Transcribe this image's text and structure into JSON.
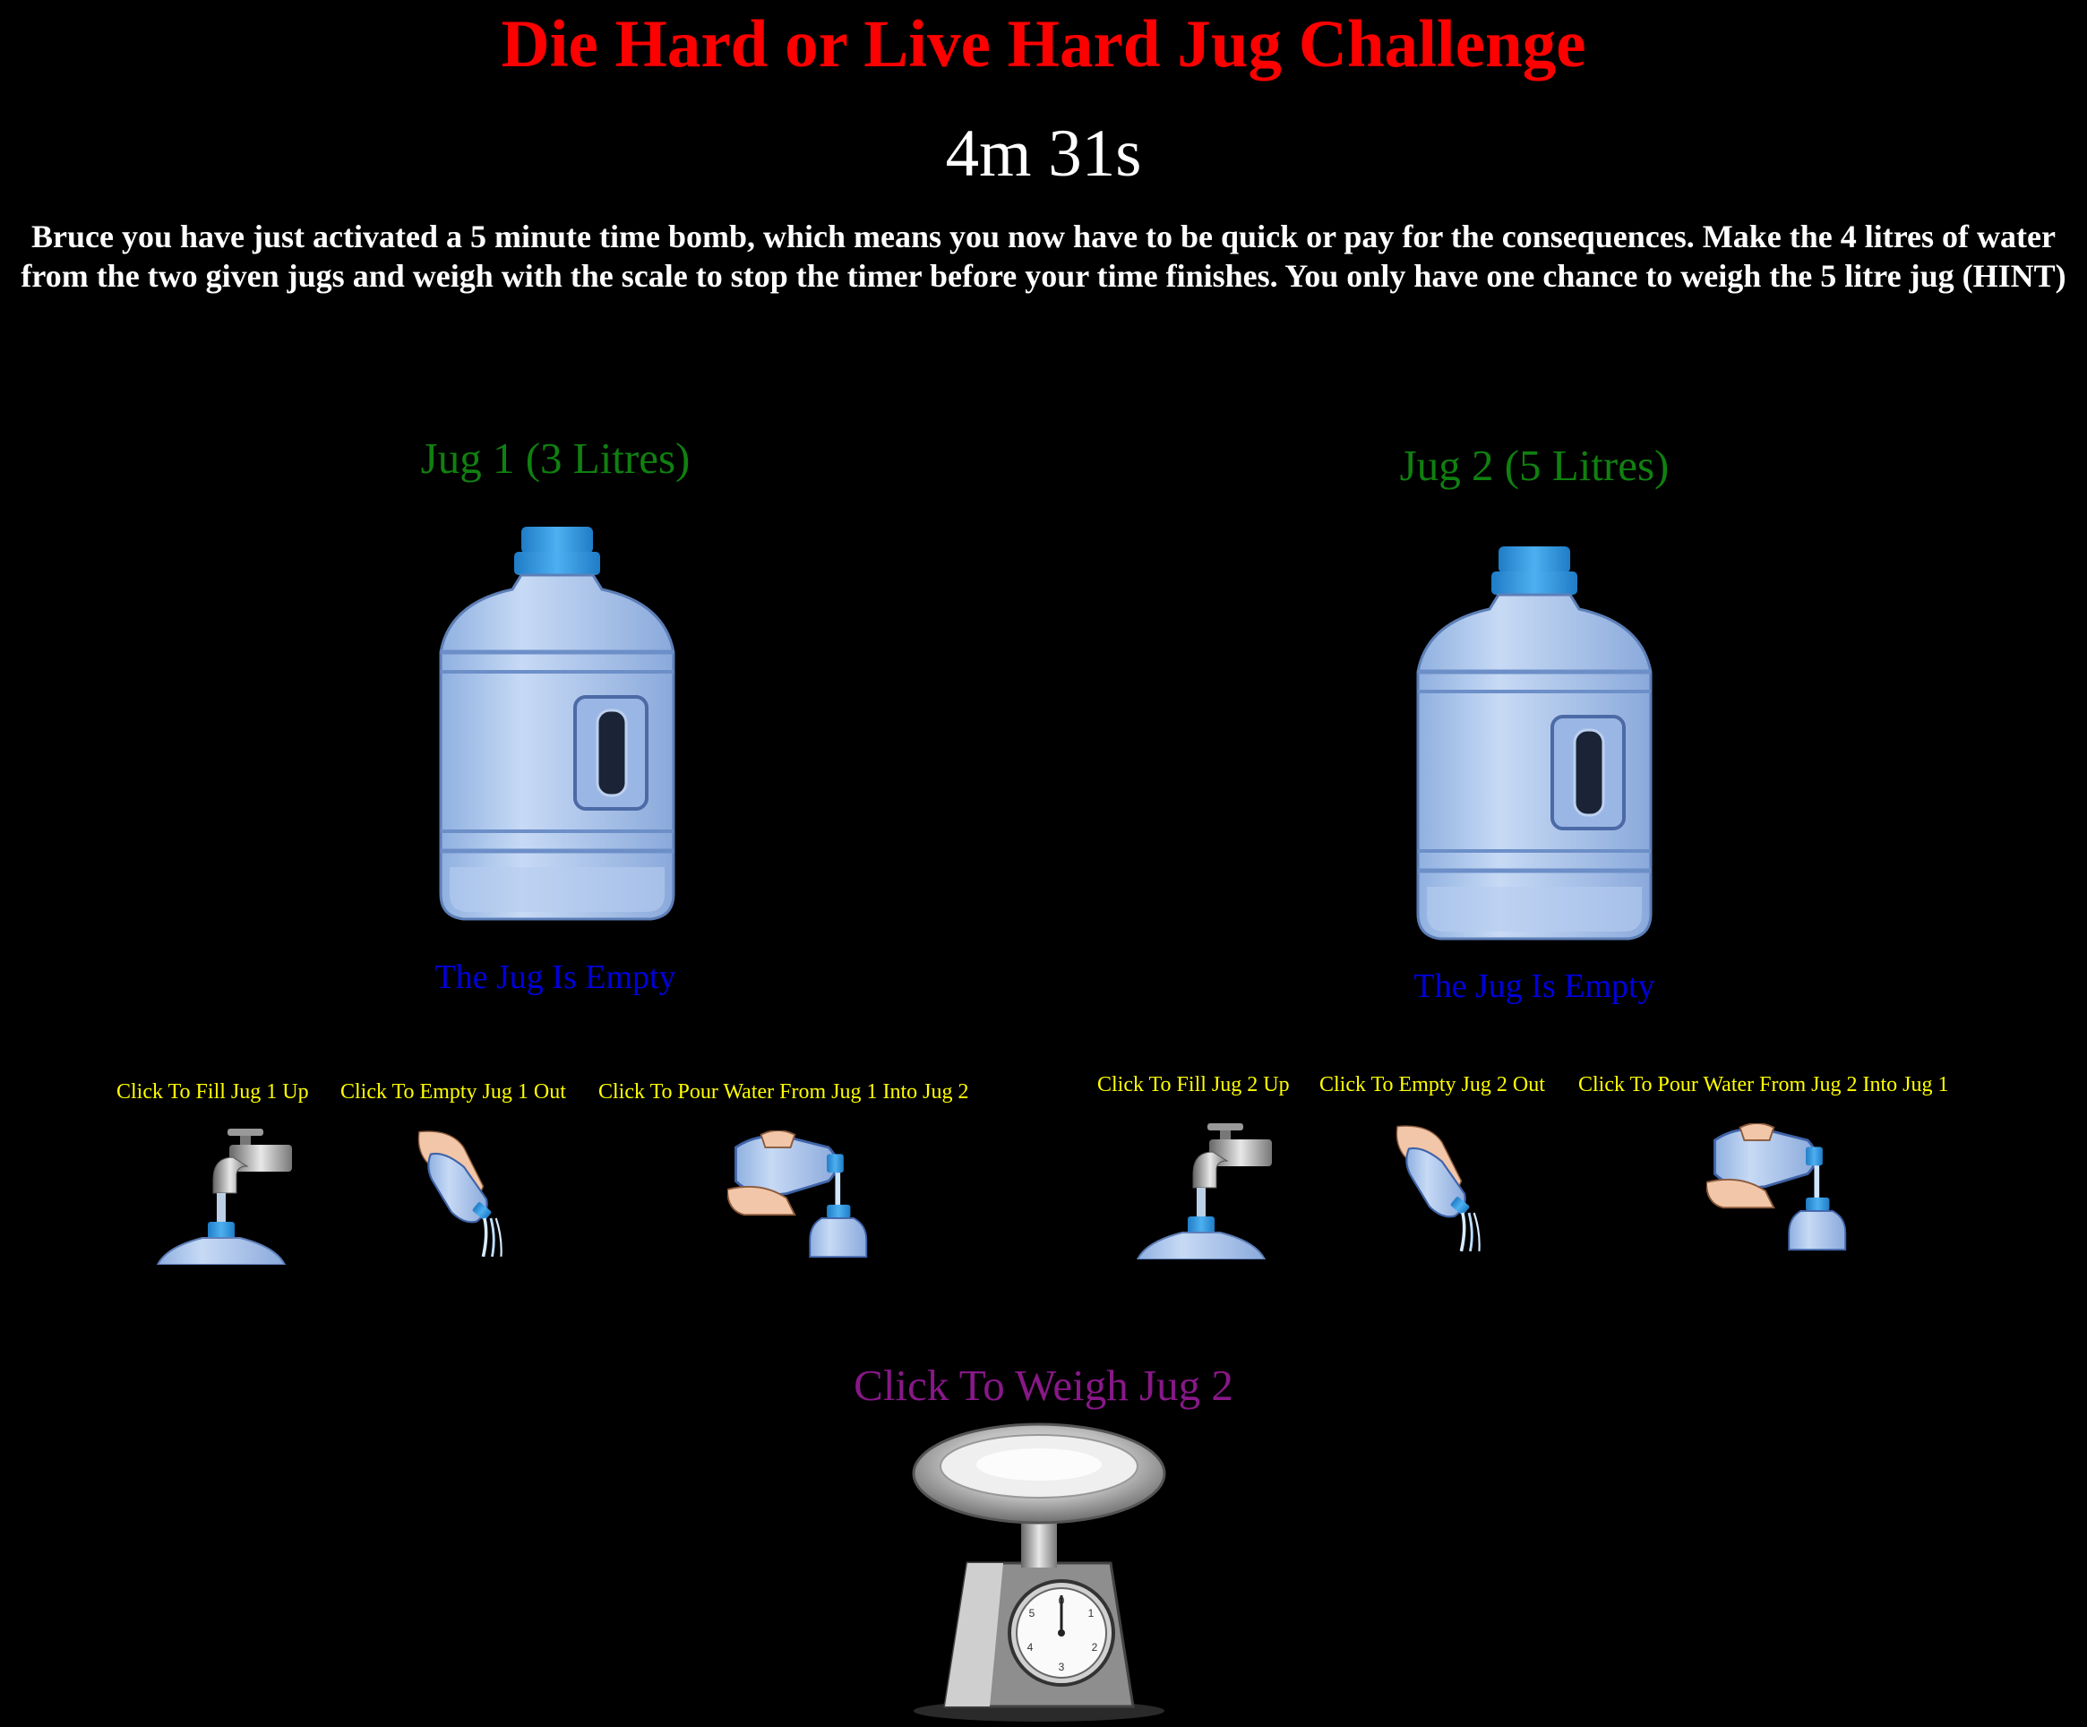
{
  "header": {
    "title": "Die Hard or Live Hard Jug Challenge",
    "timer": "4m 31s",
    "instructions": "Bruce you have just activated a 5 minute time bomb, which means you now have to be quick or pay for the consequences. Make the 4 litres of water from the two given jugs and weigh with the scale to stop the timer before your time finishes. You only have one chance to weigh the 5 litre jug (HINT)"
  },
  "jug1": {
    "title": "Jug 1 (3 Litres)",
    "status": "The Jug Is Empty",
    "fill_label": "Click To Fill Jug 1 Up",
    "empty_label": "Click To Empty Jug 1 Out",
    "pour_label": "Click To Pour Water From Jug 1 Into Jug 2"
  },
  "jug2": {
    "title": "Jug 2 (5 Litres)",
    "status": "The Jug Is Empty",
    "fill_label": "Click To Fill Jug 2 Up",
    "empty_label": "Click To Empty Jug 2 Out",
    "pour_label": "Click To Pour Water From Jug 2 Into Jug 1"
  },
  "scale": {
    "label": "Click To Weigh Jug 2"
  },
  "colors": {
    "title": "#ff0000",
    "jug_title": "#108010",
    "status": "#0000dd",
    "action": "#ffff00",
    "weigh": "#881888",
    "jug_body": "#a9c6ec",
    "jug_cap": "#2a8fd8"
  },
  "icons": {
    "jug": "water-jug-icon",
    "fill": "tap-fill-icon",
    "empty": "pour-out-icon",
    "pour": "pour-into-icon",
    "scale": "kitchen-scale-icon"
  }
}
